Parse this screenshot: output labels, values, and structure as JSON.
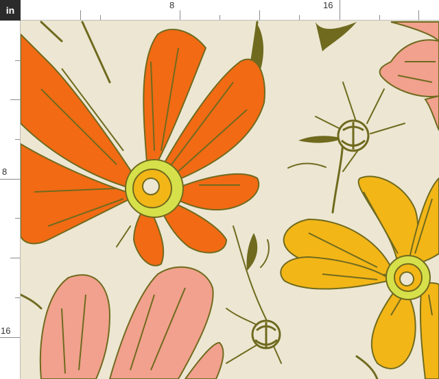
{
  "ruler": {
    "unit": "in",
    "top_labels": [
      "8",
      "16"
    ],
    "left_labels": [
      "8",
      "16"
    ]
  },
  "fabric": {
    "description_colors": {
      "background": "#ece6d2",
      "orange_petal": "#f26a14",
      "yellow_petal": "#f3b617",
      "pink_petal": "#f1a18d",
      "stem_olive": "#6f6a1e",
      "center_lime": "#d6e04a"
    }
  }
}
